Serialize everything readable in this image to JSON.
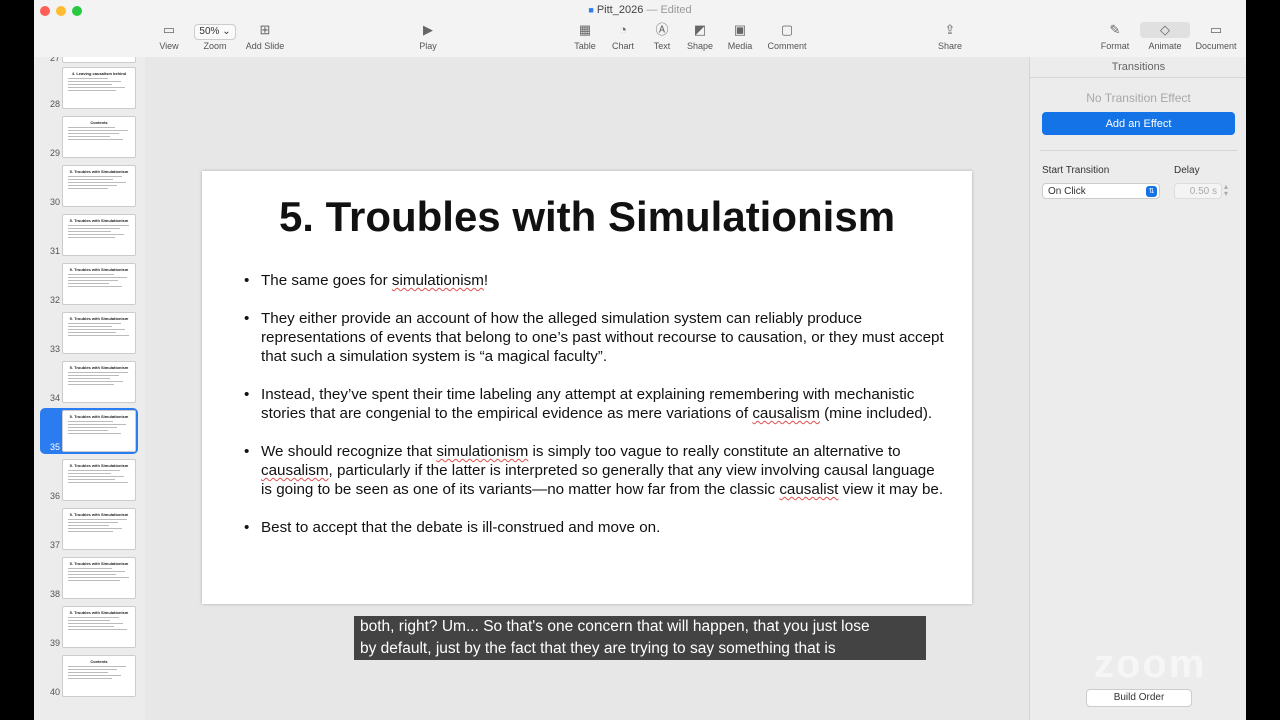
{
  "window": {
    "doc_name": "Pitt_2026",
    "separator": "—",
    "status": "Edited"
  },
  "toolbar": {
    "view": "View",
    "zoom_value": "50%",
    "zoom": "Zoom",
    "add_slide": "Add Slide",
    "play": "Play",
    "table": "Table",
    "chart": "Chart",
    "text": "Text",
    "shape": "Shape",
    "media": "Media",
    "comment": "Comment",
    "share": "Share",
    "format": "Format",
    "animate": "Animate",
    "document": "Document"
  },
  "navigator": {
    "partial_number": "27",
    "slides": [
      {
        "number": "28",
        "title": "4. Leaving causalism behind"
      },
      {
        "number": "29",
        "title": "Contents"
      },
      {
        "number": "30",
        "title": "5. Troubles with Simulationism"
      },
      {
        "number": "31",
        "title": "5. Troubles with Simulationism"
      },
      {
        "number": "32",
        "title": "5. Troubles with Simulationism"
      },
      {
        "number": "33",
        "title": "5. Troubles with Simulationism"
      },
      {
        "number": "34",
        "title": "5. Troubles with Simulationism"
      },
      {
        "number": "35",
        "title": "5. Troubles with Simulationism"
      },
      {
        "number": "36",
        "title": "5. Troubles with Simulationism"
      },
      {
        "number": "37",
        "title": "5. Troubles with Simulationism"
      },
      {
        "number": "38",
        "title": "5. Troubles with Simulationism"
      },
      {
        "number": "39",
        "title": "5. Troubles with Simulationism"
      },
      {
        "number": "40",
        "title": "Contents"
      }
    ]
  },
  "slide": {
    "title": "5. Troubles with Simulationism",
    "b1_a": "The same goes for ",
    "b1_b": "simulationism",
    "b1_c": "!",
    "b2": "They either provide an account of how the alleged simulation system can reliably produce representations of events that belong to one’s past without recourse to causation, or they must accept that such a simulation system is “a magical faculty”.",
    "b3_a": "Instead, they’ve spent their time labeling any attempt at explaining remembering with mechanistic stories that are congenial to the empirical evidence as mere variations of ",
    "b3_b": "causalism",
    "b3_c": " (mine included).",
    "b4_a": "We should recognize that ",
    "b4_b": "simulationism",
    "b4_c": " is simply too vague to really constitute an alternative to ",
    "b4_d": "causalism",
    "b4_e": ", particularly if the latter is interpreted so generally that any view involving causal language is going to be seen as one of its variants—no matter how far from the classic ",
    "b4_f": "causalist",
    "b4_g": " view it may be.",
    "b5": "Best to accept that the debate is ill-construed and move on."
  },
  "caption": {
    "line1": "both, right? Um... So that's one concern that will happen, that you just lose",
    "line2": "by default, just by the fact that they are trying to say something that is"
  },
  "inspector": {
    "header": "Transitions",
    "no_effect": "No Transition Effect",
    "add_effect": "Add an Effect",
    "start_label": "Start Transition",
    "start_value": "On Click",
    "delay_label": "Delay",
    "delay_value": "0.50 s",
    "build_order": "Build Order"
  },
  "watermark": "zoom",
  "colors": {
    "accent": "#1473e6",
    "selection": "#2a7cf0",
    "close": "#ff5f57",
    "minimize": "#febc2e",
    "maximize": "#28c840"
  }
}
